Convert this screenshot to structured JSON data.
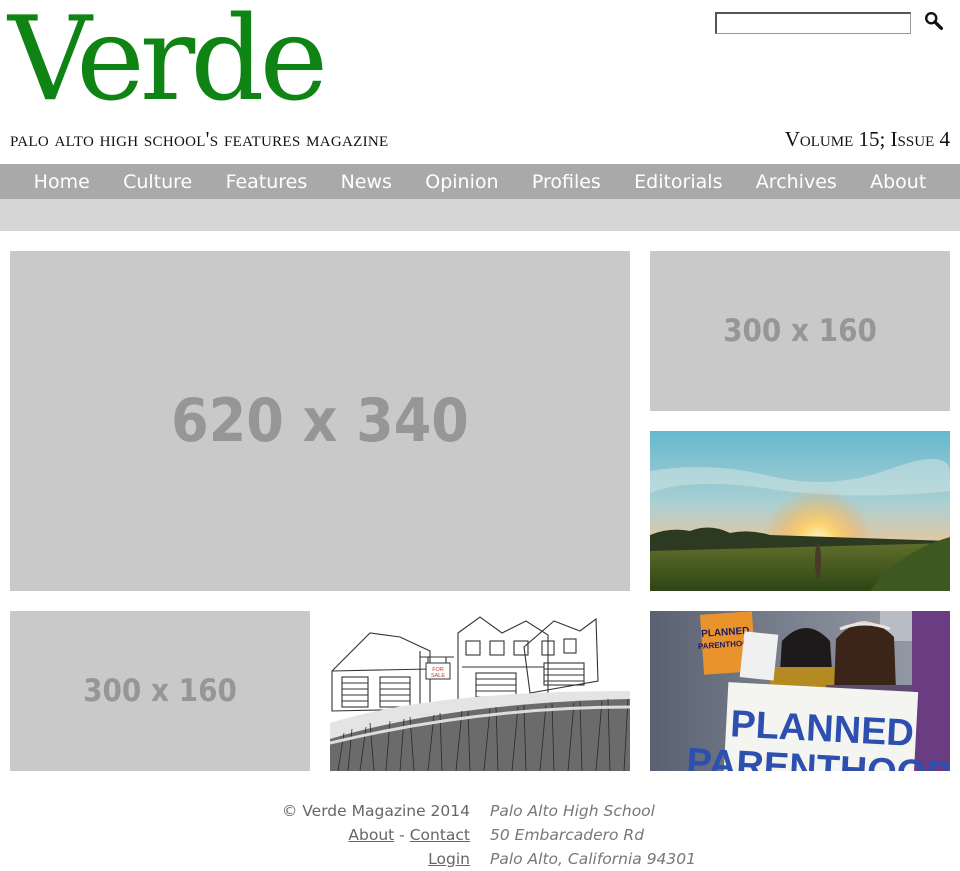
{
  "header": {
    "logo": "Verde",
    "tagline": "palo alto high school's features magazine",
    "issue": "Volume 15; Issue 4",
    "search_placeholder": ""
  },
  "nav": {
    "items": [
      {
        "label": "Home"
      },
      {
        "label": "Culture"
      },
      {
        "label": "Features"
      },
      {
        "label": "News"
      },
      {
        "label": "Opinion"
      },
      {
        "label": "Profiles"
      },
      {
        "label": "Editorials"
      },
      {
        "label": "Archives"
      },
      {
        "label": "About"
      }
    ]
  },
  "tiles": {
    "large_placeholder": "620 x 340",
    "small_placeholder_1": "300 x 160",
    "small_placeholder_2": "300 x 160",
    "house_sign": "FOR SALE",
    "protest_sign_small": "PLANNED PARENTHOOD",
    "protest_sign_big_line1": "PLANNED",
    "protest_sign_big_line2": "PARENTHOOD"
  },
  "footer": {
    "copyright": "© Verde Magazine 2014",
    "about": "About",
    "separator": "-",
    "contact": "Contact",
    "login": "Login",
    "address_line1": "Palo Alto High School",
    "address_line2": "50 Embarcadero Rd",
    "address_line3": "Palo Alto, California 94301"
  },
  "colors": {
    "brand_green": "#0f8414",
    "nav_bg": "#a9a9a9",
    "subbar_bg": "#d6d6d6",
    "placeholder_bg": "#c9c9c9"
  }
}
